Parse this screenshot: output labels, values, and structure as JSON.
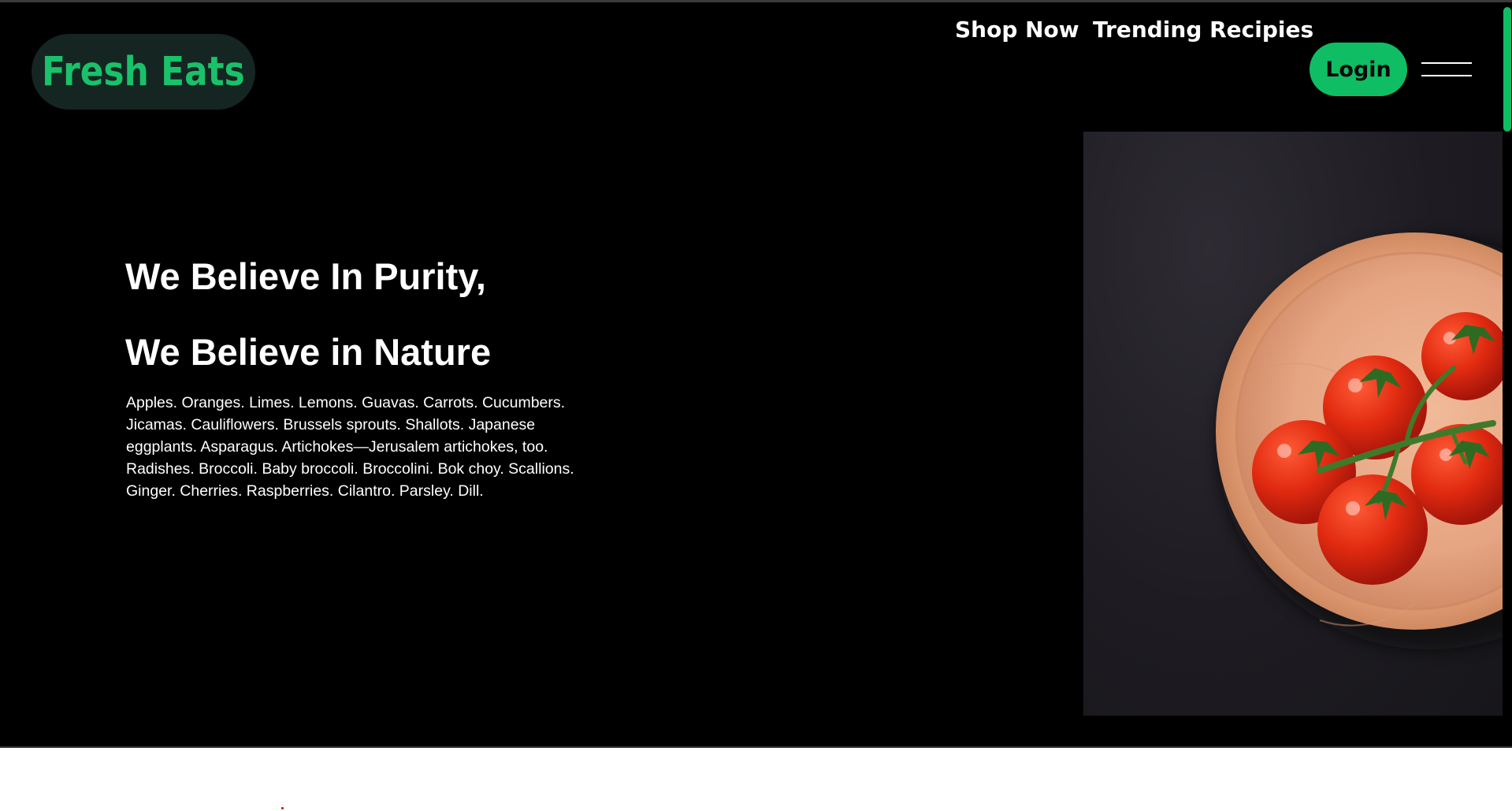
{
  "brand": {
    "name": "Fresh Eats"
  },
  "nav": {
    "links": [
      "Shop Now",
      "Trending Recipies"
    ],
    "login_label": "Login"
  },
  "hero": {
    "headline_1": "We Believe In Purity,",
    "headline_2": "We Believe in Nature",
    "description": "Apples. Oranges. Limes. Lemons. Guavas. Carrots. Cucumbers. Jicamas. Cauliflowers. Brussels sprouts. Shallots. Japanese eggplants. Asparagus. Artichokes—Jerusalem artichokes, too. Radishes. Broccoli. Baby broccoli. Broccolini. Bok choy. Scallions. Ginger. Cherries. Raspberries. Cilantro. Parsley. Dill.",
    "image": {
      "subject": "tomatoes-in-wooden-bowl"
    }
  },
  "colors": {
    "accent": "#0fbe64",
    "logo_text": "#19c26a",
    "logo_bg": "#152622",
    "hero_bg": "#000000",
    "text": "#ffffff"
  },
  "icons": {
    "menu": "hamburger-menu-icon"
  }
}
